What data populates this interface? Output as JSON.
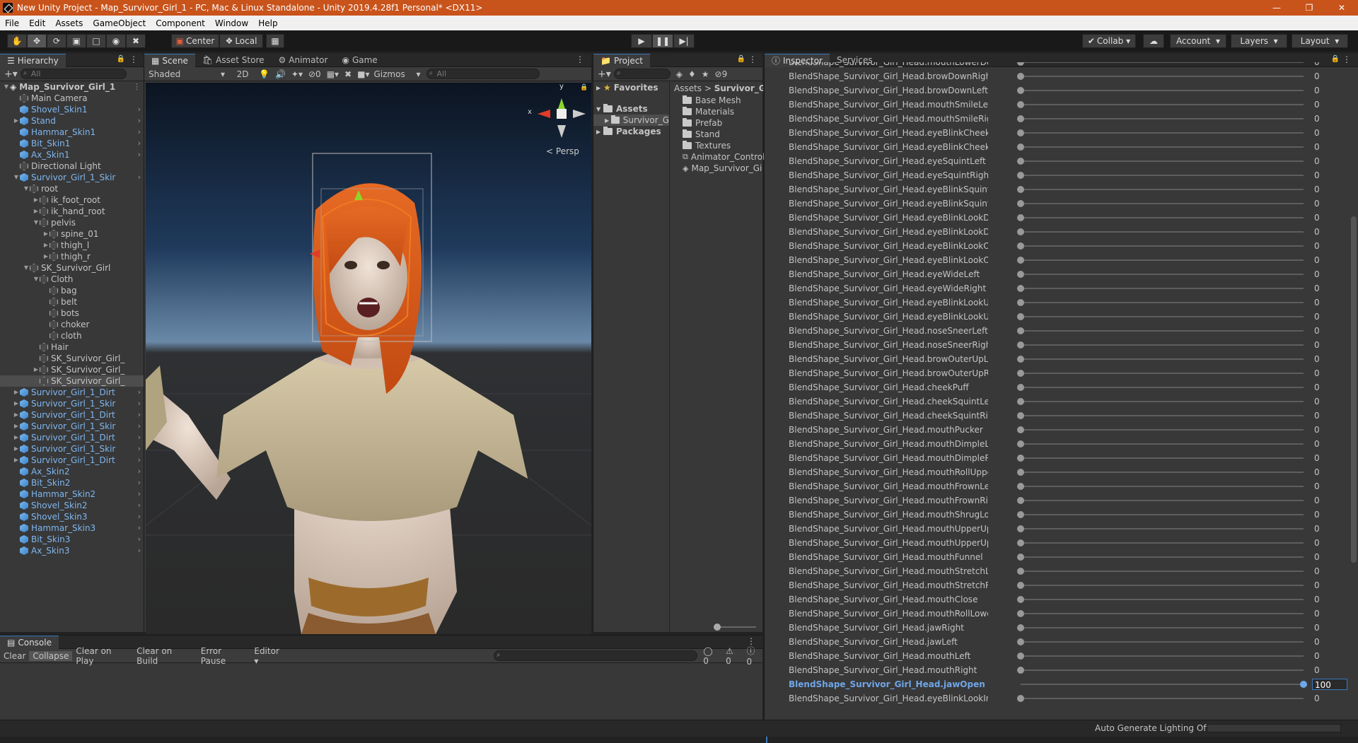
{
  "title": "New Unity Project - Map_Survivor_Girl_1 - PC, Mac & Linux Standalone - Unity 2019.4.28f1 Personal* <DX11>",
  "menu": [
    "File",
    "Edit",
    "Assets",
    "GameObject",
    "Component",
    "Window",
    "Help"
  ],
  "toolbar": {
    "center": "Center",
    "local": "Local",
    "collab": "Collab",
    "account": "Account",
    "layers": "Layers",
    "layout": "Layout"
  },
  "hierarchy": {
    "tab": "Hierarchy",
    "search_placeholder": "All",
    "items": [
      {
        "label": "Map_Survivor_Girl_1",
        "depth": 0,
        "type": "scene",
        "arrow": "down"
      },
      {
        "label": "Main Camera",
        "depth": 1,
        "type": "grey"
      },
      {
        "label": "Shovel_Skin1",
        "depth": 1,
        "type": "prefab",
        "chev": true
      },
      {
        "label": "Stand",
        "depth": 1,
        "type": "prefab",
        "arrow": "right",
        "chev": true
      },
      {
        "label": "Hammar_Skin1",
        "depth": 1,
        "type": "prefab",
        "chev": true
      },
      {
        "label": "Bit_Skin1",
        "depth": 1,
        "type": "prefab",
        "chev": true
      },
      {
        "label": "Ax_Skin1",
        "depth": 1,
        "type": "prefab",
        "chev": true
      },
      {
        "label": "Directional Light",
        "depth": 1,
        "type": "grey"
      },
      {
        "label": "Survivor_Girl_1_Skir",
        "depth": 1,
        "type": "prefab",
        "arrow": "down",
        "chev": true
      },
      {
        "label": "root",
        "depth": 2,
        "type": "grey-blue",
        "arrow": "down"
      },
      {
        "label": "ik_foot_root",
        "depth": 3,
        "type": "grey-blue",
        "arrow": "right"
      },
      {
        "label": "ik_hand_root",
        "depth": 3,
        "type": "grey-blue",
        "arrow": "right"
      },
      {
        "label": "pelvis",
        "depth": 3,
        "type": "grey-blue",
        "arrow": "down"
      },
      {
        "label": "spine_01",
        "depth": 4,
        "type": "grey-blue",
        "arrow": "right"
      },
      {
        "label": "thigh_l",
        "depth": 4,
        "type": "grey-blue",
        "arrow": "right"
      },
      {
        "label": "thigh_r",
        "depth": 4,
        "type": "grey-blue",
        "arrow": "right"
      },
      {
        "label": "SK_Survivor_Girl",
        "depth": 2,
        "type": "grey-blue",
        "arrow": "down"
      },
      {
        "label": "Cloth",
        "depth": 3,
        "type": "grey-blue",
        "arrow": "down"
      },
      {
        "label": "bag",
        "depth": 4,
        "type": "grey-blue"
      },
      {
        "label": "belt",
        "depth": 4,
        "type": "grey-blue"
      },
      {
        "label": "bots",
        "depth": 4,
        "type": "grey-blue"
      },
      {
        "label": "choker",
        "depth": 4,
        "type": "grey-blue"
      },
      {
        "label": "cloth",
        "depth": 4,
        "type": "grey-blue"
      },
      {
        "label": "Hair",
        "depth": 3,
        "type": "grey-blue"
      },
      {
        "label": "SK_Survivor_Girl_",
        "depth": 3,
        "type": "grey-blue"
      },
      {
        "label": "SK_Survivor_Girl_",
        "depth": 3,
        "type": "grey-blue",
        "arrow": "right"
      },
      {
        "label": "SK_Survivor_Girl_",
        "depth": 3,
        "type": "grey-white",
        "selected": true
      },
      {
        "label": "Survivor_Girl_1_Dirt",
        "depth": 1,
        "type": "prefab",
        "arrow": "right",
        "chev": true
      },
      {
        "label": "Survivor_Girl_1_Skir",
        "depth": 1,
        "type": "prefab",
        "arrow": "right",
        "chev": true
      },
      {
        "label": "Survivor_Girl_1_Dirt",
        "depth": 1,
        "type": "prefab",
        "arrow": "right",
        "chev": true
      },
      {
        "label": "Survivor_Girl_1_Skir",
        "depth": 1,
        "type": "prefab",
        "arrow": "right",
        "chev": true
      },
      {
        "label": "Survivor_Girl_1_Dirt",
        "depth": 1,
        "type": "prefab",
        "arrow": "right",
        "chev": true
      },
      {
        "label": "Survivor_Girl_1_Skir",
        "depth": 1,
        "type": "prefab",
        "arrow": "right",
        "chev": true
      },
      {
        "label": "Survivor_Girl_1_Dirt",
        "depth": 1,
        "type": "prefab",
        "arrow": "right",
        "chev": true
      },
      {
        "label": "Ax_Skin2",
        "depth": 1,
        "type": "prefab",
        "chev": true
      },
      {
        "label": "Bit_Skin2",
        "depth": 1,
        "type": "prefab",
        "chev": true
      },
      {
        "label": "Hammar_Skin2",
        "depth": 1,
        "type": "prefab",
        "chev": true
      },
      {
        "label": "Shovel_Skin2",
        "depth": 1,
        "type": "prefab",
        "chev": true
      },
      {
        "label": "Shovel_Skin3",
        "depth": 1,
        "type": "prefab",
        "chev": true
      },
      {
        "label": "Hammar_Skin3",
        "depth": 1,
        "type": "prefab",
        "chev": true
      },
      {
        "label": "Bit_Skin3",
        "depth": 1,
        "type": "prefab",
        "chev": true
      },
      {
        "label": "Ax_Skin3",
        "depth": 1,
        "type": "prefab",
        "chev": true
      }
    ]
  },
  "scene": {
    "tabs": [
      "Scene",
      "Asset Store",
      "Animator",
      "Game"
    ],
    "shading": "Shaded",
    "mode2d": "2D",
    "hidden_count": "0",
    "gizmos": "Gizmos",
    "search_placeholder": "All",
    "persp": "Persp",
    "axis_x": "x",
    "axis_y": "y"
  },
  "project": {
    "tab": "Project",
    "favorites": "Favorites",
    "assets": "Assets",
    "packages": "Packages",
    "survivor_folder": "Survivor_G",
    "breadcrumb": [
      "Assets",
      "Survivor_Gir"
    ],
    "hidden_count": "9",
    "contents": [
      {
        "label": "Base Mesh",
        "type": "folder"
      },
      {
        "label": "Materials",
        "type": "folder"
      },
      {
        "label": "Prefab",
        "type": "folder"
      },
      {
        "label": "Stand",
        "type": "folder"
      },
      {
        "label": "Textures",
        "type": "folder"
      },
      {
        "label": "Animator_Control",
        "type": "animator"
      },
      {
        "label": "Map_Survivor_Gi",
        "type": "scene"
      }
    ]
  },
  "inspector": {
    "tabs": [
      "Inspector",
      "Services"
    ],
    "rows": [
      {
        "label": "BlendShape_Survivor_Girl_Head.mouthLowerDownLeft",
        "value": "0"
      },
      {
        "label": "BlendShape_Survivor_Girl_Head.browDownRight",
        "value": "0"
      },
      {
        "label": "BlendShape_Survivor_Girl_Head.browDownLeft",
        "value": "0"
      },
      {
        "label": "BlendShape_Survivor_Girl_Head.mouthSmileLeft",
        "value": "0"
      },
      {
        "label": "BlendShape_Survivor_Girl_Head.mouthSmileRight",
        "value": "0"
      },
      {
        "label": "BlendShape_Survivor_Girl_Head.eyeBlinkCheekSquintLef",
        "value": "0"
      },
      {
        "label": "BlendShape_Survivor_Girl_Head.eyeBlinkCheekSquintRig",
        "value": "0"
      },
      {
        "label": "BlendShape_Survivor_Girl_Head.eyeSquintLeft",
        "value": "0"
      },
      {
        "label": "BlendShape_Survivor_Girl_Head.eyeSquintRight",
        "value": "0"
      },
      {
        "label": "BlendShape_Survivor_Girl_Head.eyeBlinkSquintLeft",
        "value": "0"
      },
      {
        "label": "BlendShape_Survivor_Girl_Head.eyeBlinkSquintRight",
        "value": "0"
      },
      {
        "label": "BlendShape_Survivor_Girl_Head.eyeBlinkLookDownLeft",
        "value": "0"
      },
      {
        "label": "BlendShape_Survivor_Girl_Head.eyeBlinkLookDownRight",
        "value": "0"
      },
      {
        "label": "BlendShape_Survivor_Girl_Head.eyeBlinkLookOutRight",
        "value": "0"
      },
      {
        "label": "BlendShape_Survivor_Girl_Head.eyeBlinkLookOutLeft",
        "value": "0"
      },
      {
        "label": "BlendShape_Survivor_Girl_Head.eyeWideLeft",
        "value": "0"
      },
      {
        "label": "BlendShape_Survivor_Girl_Head.eyeWideRight",
        "value": "0"
      },
      {
        "label": "BlendShape_Survivor_Girl_Head.eyeBlinkLookUpLeft",
        "value": "0"
      },
      {
        "label": "BlendShape_Survivor_Girl_Head.eyeBlinkLookUpRight",
        "value": "0"
      },
      {
        "label": "BlendShape_Survivor_Girl_Head.noseSneerLeft",
        "value": "0"
      },
      {
        "label": "BlendShape_Survivor_Girl_Head.noseSneerRight",
        "value": "0"
      },
      {
        "label": "BlendShape_Survivor_Girl_Head.browOuterUpLeft",
        "value": "0"
      },
      {
        "label": "BlendShape_Survivor_Girl_Head.browOuterUpRight",
        "value": "0"
      },
      {
        "label": "BlendShape_Survivor_Girl_Head.cheekPuff",
        "value": "0"
      },
      {
        "label": "BlendShape_Survivor_Girl_Head.cheekSquintLeft",
        "value": "0"
      },
      {
        "label": "BlendShape_Survivor_Girl_Head.cheekSquintRight",
        "value": "0"
      },
      {
        "label": "BlendShape_Survivor_Girl_Head.mouthPucker",
        "value": "0"
      },
      {
        "label": "BlendShape_Survivor_Girl_Head.mouthDimpleLeft",
        "value": "0"
      },
      {
        "label": "BlendShape_Survivor_Girl_Head.mouthDimpleRight",
        "value": "0"
      },
      {
        "label": "BlendShape_Survivor_Girl_Head.mouthRollUpper",
        "value": "0"
      },
      {
        "label": "BlendShape_Survivor_Girl_Head.mouthFrownLeft",
        "value": "0"
      },
      {
        "label": "BlendShape_Survivor_Girl_Head.mouthFrownRight",
        "value": "0"
      },
      {
        "label": "BlendShape_Survivor_Girl_Head.mouthShrugLower",
        "value": "0"
      },
      {
        "label": "BlendShape_Survivor_Girl_Head.mouthUpperUpRight",
        "value": "0"
      },
      {
        "label": "BlendShape_Survivor_Girl_Head.mouthUpperUpLeft",
        "value": "0"
      },
      {
        "label": "BlendShape_Survivor_Girl_Head.mouthFunnel",
        "value": "0"
      },
      {
        "label": "BlendShape_Survivor_Girl_Head.mouthStretchLeft",
        "value": "0"
      },
      {
        "label": "BlendShape_Survivor_Girl_Head.mouthStretchRight",
        "value": "0"
      },
      {
        "label": "BlendShape_Survivor_Girl_Head.mouthClose",
        "value": "0"
      },
      {
        "label": "BlendShape_Survivor_Girl_Head.mouthRollLower",
        "value": "0"
      },
      {
        "label": "BlendShape_Survivor_Girl_Head.jawRight",
        "value": "0"
      },
      {
        "label": "BlendShape_Survivor_Girl_Head.jawLeft",
        "value": "0"
      },
      {
        "label": "BlendShape_Survivor_Girl_Head.mouthLeft",
        "value": "0"
      },
      {
        "label": "BlendShape_Survivor_Girl_Head.mouthRight",
        "value": "0"
      },
      {
        "label": "BlendShape_Survivor_Girl_Head.jawOpen",
        "value": "100",
        "highlight": true
      },
      {
        "label": "BlendShape_Survivor_Girl_Head.eyeBlinkLookInRight",
        "value": "0"
      }
    ]
  },
  "console": {
    "tab": "Console",
    "buttons": [
      "Clear",
      "Collapse",
      "Clear on Play",
      "Clear on Build",
      "Error Pause",
      "Editor"
    ],
    "counts": {
      "log": "0",
      "warn": "0",
      "error": "0"
    }
  },
  "status": {
    "text": "Auto Generate Lighting Off"
  },
  "colors": {
    "titlebar": "#c8531b",
    "prefab_text": "#7fb6ef",
    "accent": "#3a79bb"
  }
}
